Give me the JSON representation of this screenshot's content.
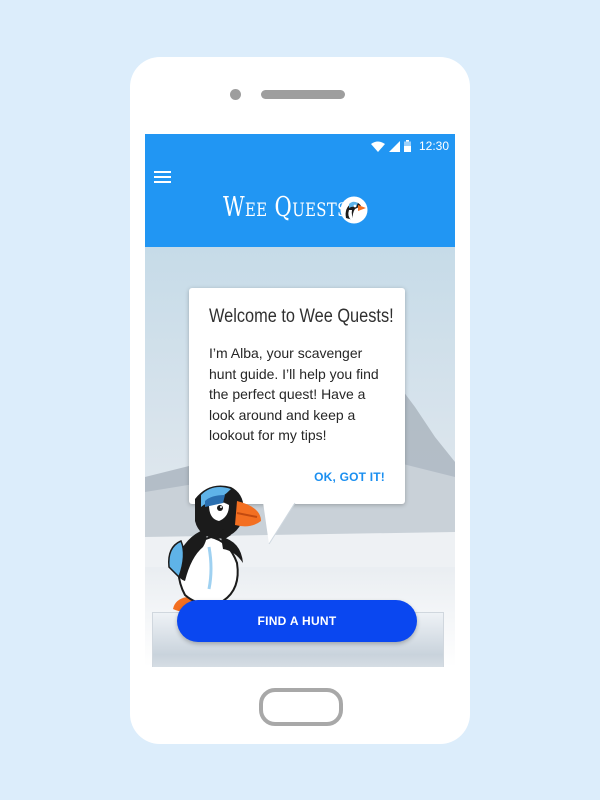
{
  "status_bar": {
    "time": "12:30",
    "icons": [
      "wifi-icon",
      "signal-icon",
      "battery-icon"
    ]
  },
  "app_bar": {
    "title": "Wee Quests",
    "menu_icon": "menu-icon",
    "logo_icon": "puffin-logo-icon"
  },
  "dialog": {
    "title": "Welcome to Wee Quests!",
    "body": "I’m Alba, your scavenger hunt guide. I’ll help you find the perfect quest! Have a look around and keep a lookout for my tips!",
    "action_label": "OK, GOT IT!"
  },
  "cta": {
    "label": "FIND A HUNT"
  },
  "colors": {
    "background": "#dcedfb",
    "app_bar": "#2196f3",
    "cta": "#0a47f0",
    "dialog_action": "#1b8ff0"
  }
}
